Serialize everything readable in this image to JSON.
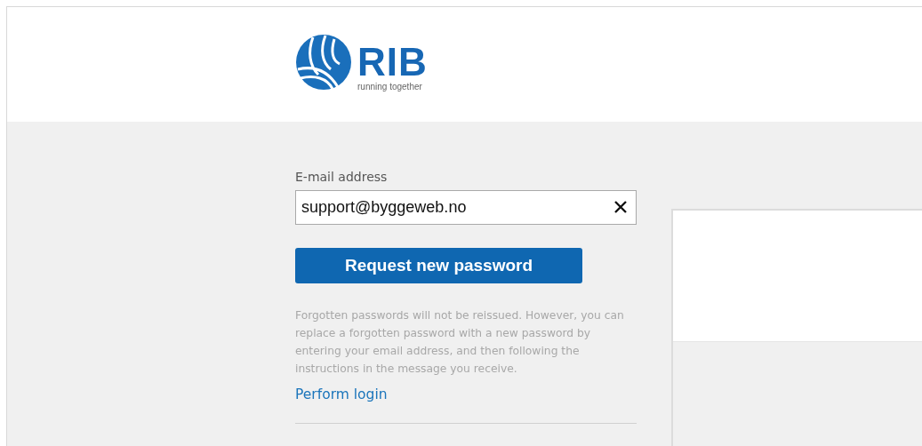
{
  "logo": {
    "name": "RIB",
    "tagline": "running together"
  },
  "email": {
    "label": "E-mail address",
    "value": "support@byggeweb.no"
  },
  "submit_button": "Request new password",
  "help_text": "Forgotten passwords will not be reissued. However, you can replace a forgotten password with a new password by entering your email address, and then following the instructions in the message you receive.",
  "login_link": "Perform login"
}
